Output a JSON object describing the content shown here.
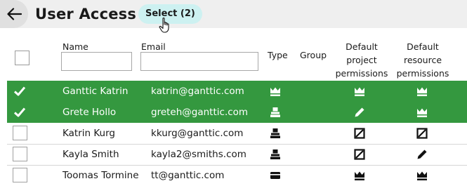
{
  "header": {
    "title": "User Access",
    "select_label": "Select (2)"
  },
  "columns": {
    "name": "Name",
    "email": "Email",
    "type": "Type",
    "group": "Group",
    "default_project_permissions": "Default project permissions",
    "default_resource_permissions": "Default resource permissions"
  },
  "filters": {
    "name_value": "",
    "email_value": ""
  },
  "users": [
    {
      "name": "Ganttic Katrin",
      "email": "katrin@ganttic.com",
      "selected": true,
      "type_icon": "crown-icon",
      "project_perm_icon": "crown-icon",
      "resource_perm_icon": "crown-icon"
    },
    {
      "name": "Grete Hollo",
      "email": "greteh@ganttic.com",
      "selected": true,
      "type_icon": "user-icon",
      "project_perm_icon": "pencil-icon",
      "resource_perm_icon": "crown-icon"
    },
    {
      "name": "Katrin Kurg",
      "email": "kkurg@ganttic.com",
      "selected": false,
      "type_icon": "user-icon",
      "project_perm_icon": "no-access-icon",
      "resource_perm_icon": "no-access-icon"
    },
    {
      "name": "Kayla Smith",
      "email": "kayla2@smiths.com",
      "selected": false,
      "type_icon": "user-icon",
      "project_perm_icon": "no-access-icon",
      "resource_perm_icon": "pencil-icon"
    },
    {
      "name": "Toomas Tormine",
      "email": "tt@ganttic.com",
      "selected": false,
      "type_icon": "card-icon",
      "project_perm_icon": "crown-icon",
      "resource_perm_icon": "crown-icon"
    }
  ],
  "colors": {
    "selected_row": "#34983f",
    "select_pill": "#cdf1f1",
    "header_bar": "#efefef"
  }
}
